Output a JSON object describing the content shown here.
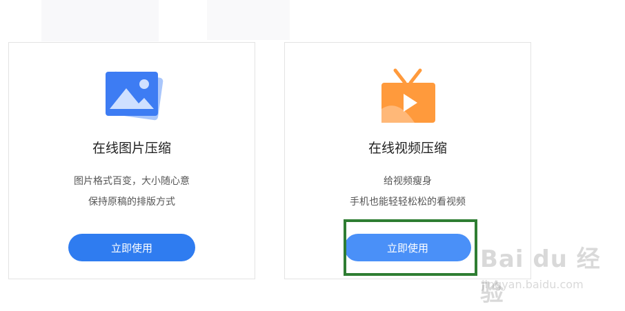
{
  "cards": [
    {
      "title": "在线图片压缩",
      "desc_line1": "图片格式百变，大小随心意",
      "desc_line2": "保持原稿的排版方式",
      "button_label": "立即使用",
      "icon": "image-icon"
    },
    {
      "title": "在线视频压缩",
      "desc_line1": "给视频瘦身",
      "desc_line2": "手机也能轻轻松松的看视频",
      "button_label": "立即使用",
      "icon": "tv-video-icon"
    }
  ],
  "watermark": {
    "main": "Bai du 经验",
    "sub": "jingyan.baidu.com"
  },
  "colors": {
    "button_left": "#2f7cf0",
    "button_right": "#4a90f8",
    "highlight": "#2e7d32",
    "image_icon": "#3d7cf3",
    "tv_icon": "#ff9a3c"
  }
}
